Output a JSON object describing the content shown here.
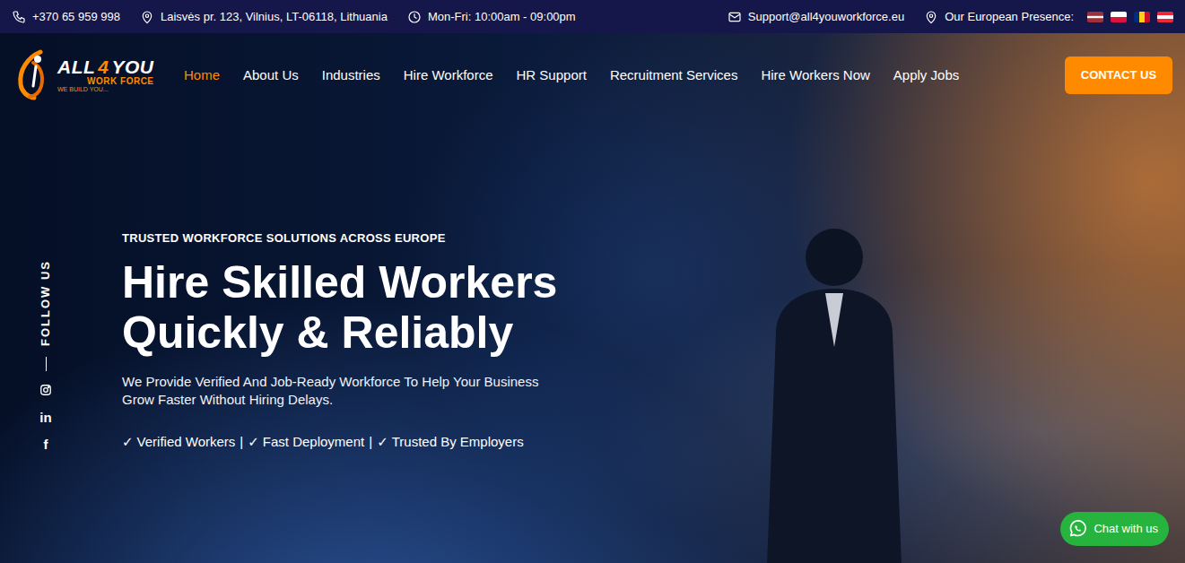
{
  "topbar": {
    "phone": "+370 65 959 998",
    "address": "Laisvės pr. 123, Vilnius, LT-06118, Lithuania",
    "hours": "Mon-Fri: 10:00am - 09:00pm",
    "email": "Support@all4youworkforce.eu",
    "presence": "Our European Presence:"
  },
  "logo": {
    "word1": "ALL",
    "number": "4",
    "word2": "YOU",
    "sub": "WORK FORCE",
    "tagline": "WE BUILD YOU..."
  },
  "nav": [
    {
      "label": "Home",
      "selected": true
    },
    {
      "label": "About Us",
      "selected": false
    },
    {
      "label": "Industries",
      "selected": false
    },
    {
      "label": "Hire Workforce",
      "selected": false
    },
    {
      "label": "HR Support",
      "selected": false
    },
    {
      "label": "Recruitment Services",
      "selected": false
    },
    {
      "label": "Hire Workers Now",
      "selected": false
    },
    {
      "label": "Apply Jobs",
      "selected": false
    }
  ],
  "contact_button": "CONTACT US",
  "follow": {
    "label": "FOLLOW US",
    "social": [
      {
        "kind": "instagram"
      },
      {
        "kind": "linkedin",
        "glyph": "in"
      },
      {
        "kind": "facebook",
        "glyph": "f"
      }
    ]
  },
  "hero": {
    "eyebrow": "TRUSTED WORKFORCE SOLUTIONS ACROSS EUROPE",
    "title_lines": [
      "Hire Skilled Workers",
      "Quickly & Reliably"
    ],
    "subtitle": "We Provide Verified And Job-Ready Workforce To Help Your Business Grow Faster Without Hiring Delays.",
    "check_mark": "✓",
    "separator": "|",
    "checks": [
      "Verified Workers",
      "Fast Deployment",
      "Trusted By Employers"
    ]
  },
  "chat_button": "Chat with us"
}
